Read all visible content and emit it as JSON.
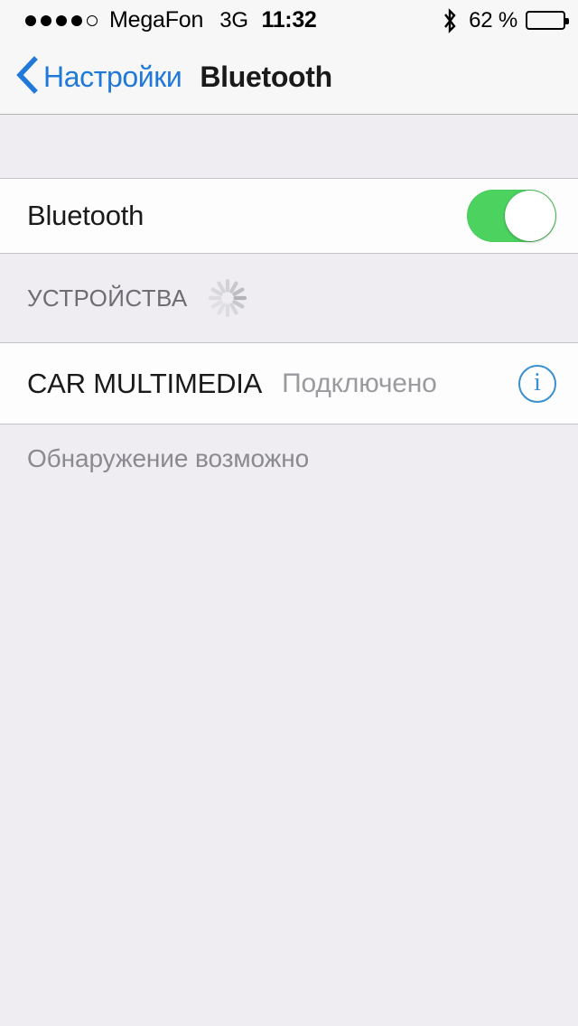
{
  "status_bar": {
    "signal_dots_total": 5,
    "signal_dots_filled": 4,
    "carrier": "MegaFon",
    "network": "3G",
    "time": "11:32",
    "bluetooth_icon": "bluetooth-icon",
    "battery_percent_label": "62 %",
    "battery_level": 62
  },
  "nav_bar": {
    "back_icon": "chevron-left-icon",
    "back_label": "Настройки",
    "title": "Bluetooth"
  },
  "bluetooth_row": {
    "label": "Bluetooth",
    "toggle_state": "on",
    "toggle_on_color": "#4cd35f"
  },
  "devices_section": {
    "header": "УСТРОЙСТВА",
    "spinner_icon": "activity-indicator-spinner",
    "items": [
      {
        "name": "CAR MULTIMEDIA",
        "status": "Подключено",
        "info_icon": "info-circle-icon",
        "info_icon_color": "#3a8fcf"
      }
    ]
  },
  "footer": {
    "discoverable_text": "Обнаружение возможно"
  },
  "colors": {
    "accent_blue": "#2079d8",
    "background": "#efedf2",
    "row_background": "#fdfdfd",
    "separator": "#c4c4c6",
    "secondary_text": "#8a8a8f"
  }
}
